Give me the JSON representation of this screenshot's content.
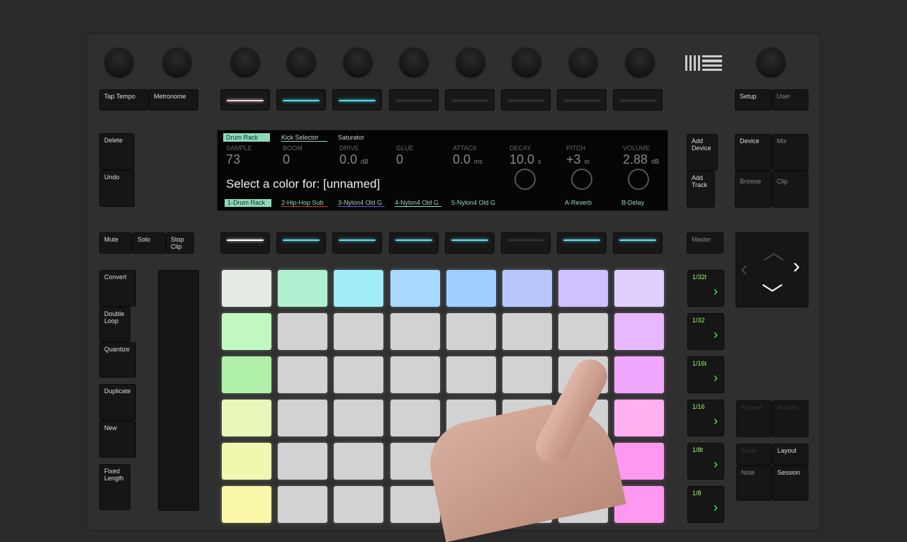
{
  "logo": "Ableton Push",
  "top_buttons": {
    "tap_tempo": "Tap Tempo",
    "metronome": "Metronome",
    "setup": "Setup",
    "user": "User"
  },
  "left_buttons": {
    "delete": "Delete",
    "undo": "Undo",
    "mute": "Mute",
    "solo": "Solo",
    "stop_clip": "Stop Clip",
    "convert": "Convert",
    "double_loop": "Double Loop",
    "quantize": "Quantize",
    "duplicate": "Duplicate",
    "new": "New",
    "fixed_length": "Fixed Length"
  },
  "right_buttons": {
    "add_device": "Add Device",
    "add_track": "Add Track",
    "device": "Device",
    "mix": "Mix",
    "browse": "Browse",
    "clip": "Clip",
    "master": "Master",
    "repeat": "Repeat",
    "accent": "Accent",
    "scale": "Scale",
    "layout": "Layout",
    "note": "Note",
    "session": "Session"
  },
  "display": {
    "tabs": [
      "Drum Rack",
      "Kick Selector",
      "Saturator"
    ],
    "params": [
      {
        "label": "SAMPLE",
        "value": "73",
        "unit": ""
      },
      {
        "label": "BOOM",
        "value": "0",
        "unit": ""
      },
      {
        "label": "DRIVE",
        "value": "0.0",
        "unit": "dB"
      },
      {
        "label": "GLUE",
        "value": "0",
        "unit": ""
      },
      {
        "label": "ATTACK",
        "value": "0.0",
        "unit": "ms"
      },
      {
        "label": "DECAY",
        "value": "10.0",
        "unit": "s"
      },
      {
        "label": "PITCH",
        "value": "+3",
        "unit": "st"
      },
      {
        "label": "VOLUME",
        "value": "2.88",
        "unit": "dB"
      }
    ],
    "message": "Select a color for: [unnamed]",
    "tracks": [
      {
        "name": "1-Drum Rack",
        "color": "#7fe0c0"
      },
      {
        "name": "2-Hip-Hop Sub",
        "color": "#e03030"
      },
      {
        "name": "3-Nylon4 Old G",
        "color": "#8040ff"
      },
      {
        "name": "4-Nylon4 Old G",
        "color": "#7fe0c0"
      },
      {
        "name": "5-Nylon4 Old G",
        "color": ""
      },
      {
        "name": "",
        "color": ""
      },
      {
        "name": "A-Reverb",
        "color": ""
      },
      {
        "name": "B-Delay",
        "color": ""
      }
    ]
  },
  "upper_select_colors": [
    "#ffd0e0",
    "#50e0f0",
    "#50e0f0",
    "#333",
    "#333",
    "#333",
    "#333",
    "#333"
  ],
  "lower_select_colors": [
    "#ffffff",
    "#60e0f0",
    "#60e0f0",
    "#60e0f0",
    "#60e0f0",
    "#333",
    "#60e0f0",
    "#60e0f0"
  ],
  "scenes": [
    "1/32t",
    "1/32",
    "1/16t",
    "1/16",
    "1/8t",
    "1/8"
  ],
  "pads": [
    [
      "#e4ece4",
      "#b0f0d0",
      "#a0ecf8",
      "#a8d8ff",
      "#a0d0ff",
      "#b8c8ff",
      "#d0c0ff",
      "#e0d0ff"
    ],
    [
      "#c0f8c0",
      "#d2d2d2",
      "#d2d2d2",
      "#d2d2d2",
      "#d2d2d2",
      "#d2d2d2",
      "#d2d2d2",
      "#e8b8ff"
    ],
    [
      "#b0f0a8",
      "#d2d2d2",
      "#d2d2d2",
      "#d2d2d2",
      "#d2d2d2",
      "#d2d2d2",
      "#d2d2d2",
      "#f0a8ff"
    ],
    [
      "#e8f8b8",
      "#d2d2d2",
      "#d2d2d2",
      "#d2d2d2",
      "#d2d2d2",
      "#d2d2d2",
      "#d2d2d2",
      "#ffb0f0"
    ],
    [
      "#f0f8b0",
      "#d2d2d2",
      "#d2d2d2",
      "#d2d2d2",
      "#d2d2d2",
      "#d2d2d2",
      "#d2d2d2",
      "#ff98f0"
    ],
    [
      "#f8f8a8",
      "#d2d2d2",
      "#d2d2d2",
      "#d2d2d2",
      "#d2d2d2",
      "#d2d2d2",
      "#d2d2d2",
      "#ff98f0"
    ]
  ]
}
